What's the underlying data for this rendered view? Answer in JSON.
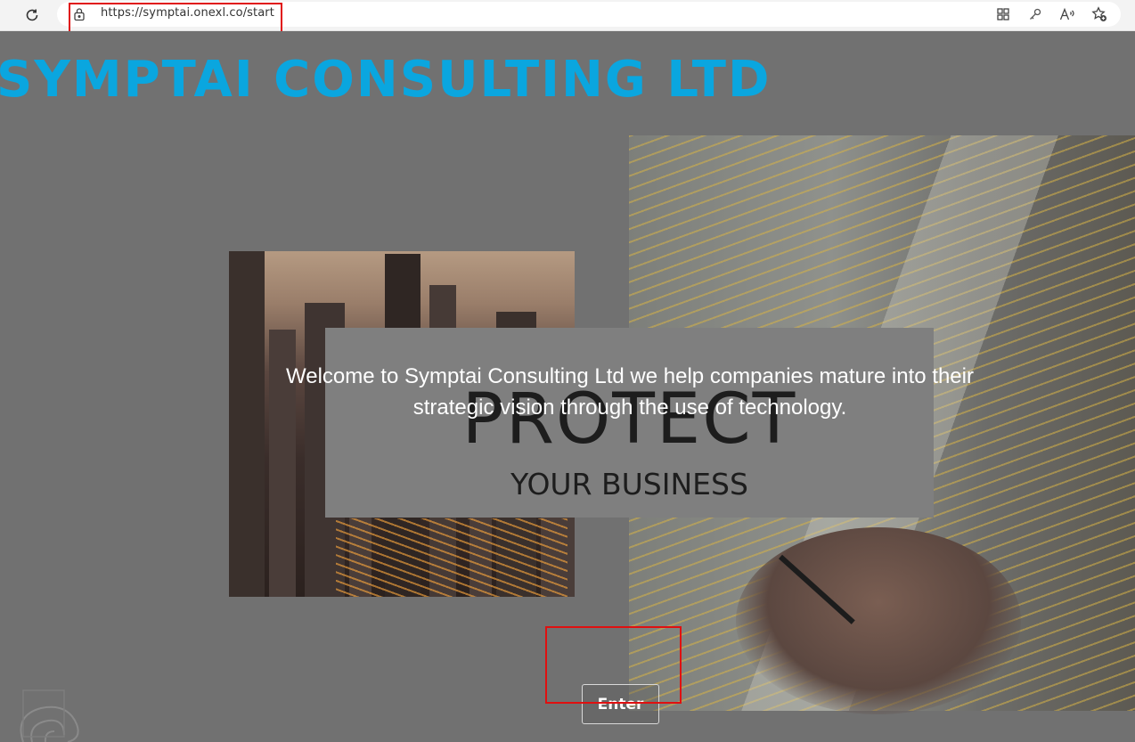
{
  "browser": {
    "url": "https://symptai.onexl.co/start",
    "icons": [
      "reload-icon",
      "lock-icon",
      "apps-icon",
      "key-icon",
      "read-aloud-icon",
      "favorites-add-icon"
    ]
  },
  "site": {
    "title": "SYMPTAI CONSULTING LTD",
    "title_color": "#0aa6df",
    "hero_word": "PROTECT",
    "hero_sub": "YOUR BUSINESS",
    "welcome_text": "Welcome to Symptai Consulting Ltd we help companies mature into their strategic vision through the use of technology.",
    "enter_label": "Enter"
  },
  "annotations": {
    "highlight_color": "#e01010"
  }
}
